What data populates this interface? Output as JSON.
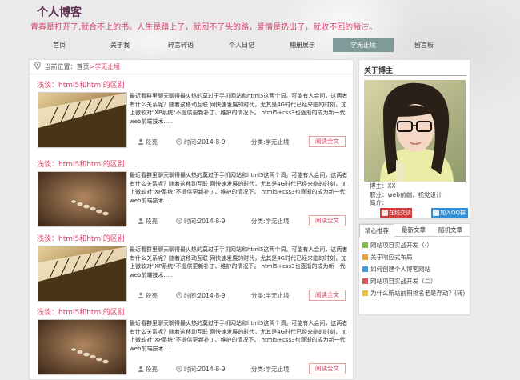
{
  "header": {
    "site_title": "个人博客",
    "slogan": "青春是打开了,就合不上的书。人生是踏上了，就回不了头的路，爱情是扔出了，就收不回的赌注。"
  },
  "nav": {
    "items": [
      {
        "label": "首页"
      },
      {
        "label": "关于我"
      },
      {
        "label": "碎言碎语"
      },
      {
        "label": "个人日记"
      },
      {
        "label": "相册展示"
      },
      {
        "label": "学无止境"
      },
      {
        "label": "留言板"
      }
    ],
    "active_index": 5
  },
  "breadcrumb": {
    "prefix": "当前位置：",
    "home": "首页",
    "sep": ">",
    "current": "学无止境"
  },
  "articles": [
    {
      "title": "浅谈：html5和html的区别",
      "excerpt": "最近看群里聊天聊得最火热的莫过于手机网站和html5这两个词。可能有人会问，这两者有什么关系呢？随着这移动互联 网快速发展的时代，尤其是4G时代已经来临的时刻，加上微软对\"XP系统\"不提供更新补丁、维护的情况下。 html5+css3也逐渐的成为新一代web前端技术.....",
      "author": "段亮",
      "time": "时间:2014-8-9",
      "category": "分类:学无止境",
      "read_more": "阅读全文",
      "thumb": "piano"
    },
    {
      "title": "浅谈：html5和html的区别",
      "excerpt": "最近看群里聊天聊得最火热的莫过于手机网站和html5这两个词。可能有人会问，这两者有什么关系呢？随着这移动互联 网快速发展的时代，尤其是4G时代已经来临的时刻，加上微软对\"XP系统\"不提供更新补丁、维护的情况下。 html5+css3也逐渐的成为新一代web前端技术.....",
      "author": "段亮",
      "time": "时间:2014-8-9",
      "category": "分类:学无止境",
      "read_more": "阅读全文",
      "thumb": "pebbles"
    },
    {
      "title": "浅谈：html5和html的区别",
      "excerpt": "最近看群里聊天聊得最火热的莫过于手机网站和html5这两个词。可能有人会问，这两者有什么关系呢？随着这移动互联 网快速发展的时代，尤其是4G时代已经来临的时刻，加上微软对\"XP系统\"不提供更新补丁、维护的情况下。 html5+css3也逐渐的成为新一代web前端技术.....",
      "author": "段亮",
      "time": "时间:2014-8-9",
      "category": "分类:学无止境",
      "read_more": "阅读全文",
      "thumb": "piano"
    },
    {
      "title": "浅谈：html5和html的区别",
      "excerpt": "最近看群里聊天聊得最火热的莫过于手机网站和html5这两个词。可能有人会问，这两者有什么关系呢？随着这移动互联 网快速发展的时代，尤其是4G时代已经来临的时刻，加上微软对\"XP系统\"不提供更新补丁、维护的情况下。 html5+css3也逐渐的成为新一代web前端技术.....",
      "author": "段亮",
      "time": "时间:2014-8-9",
      "category": "分类:学无止境",
      "read_more": "阅读全文",
      "thumb": "pebbles"
    }
  ],
  "about": {
    "title": "关于博主",
    "name_line": "博主：XX",
    "job_line": "职业：web前端、视觉设计",
    "bio_line": "简介：",
    "btn_chat": "在线交谈",
    "btn_qq": "加入QQ群"
  },
  "recommend": {
    "tabs": [
      "精心推荐",
      "最新文章",
      "随机文章"
    ],
    "active_tab": 0,
    "items": [
      {
        "label": "网站项目实战开发（-）",
        "color": "#7fbf3f"
      },
      {
        "label": "关于响应式布局",
        "color": "#f0a030"
      },
      {
        "label": "如何创建个人博客网站",
        "color": "#3aa0e0"
      },
      {
        "label": "网站项目实战开发（二）",
        "color": "#e05050"
      },
      {
        "label": "为什么新站前期排名老是浮动？(转)",
        "color": "#f0c030"
      }
    ]
  },
  "colors": {
    "accent": "#d5456b",
    "nav_active": "#7f9a98",
    "title": "#5a2e4e"
  }
}
